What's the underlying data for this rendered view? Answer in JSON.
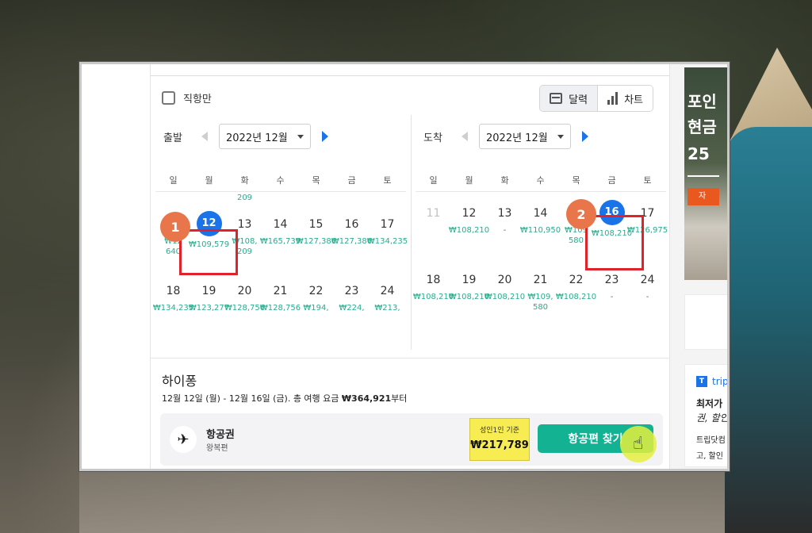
{
  "filters": {
    "direct_only_label": "직항만"
  },
  "view_toggle": {
    "calendar_label": "달력",
    "chart_label": "차트"
  },
  "departure": {
    "label": "출발",
    "month": "2022년 12월",
    "weekdays": [
      "일",
      "월",
      "화",
      "수",
      "목",
      "금",
      "토"
    ],
    "partial_row_price": "209",
    "rows": [
      [
        {
          "day": "11",
          "price": "₩12\n640",
          "muted": false
        },
        {
          "day": "12",
          "price": "₩109,579",
          "selected": true
        },
        {
          "day": "13",
          "price": "₩108,\n209"
        },
        {
          "day": "14",
          "price": "₩165,739"
        },
        {
          "day": "15",
          "price": "₩127,386"
        },
        {
          "day": "16",
          "price": "₩127,386"
        },
        {
          "day": "17",
          "price": "₩134,235"
        }
      ],
      [
        {
          "day": "18",
          "price": "₩134,235"
        },
        {
          "day": "19",
          "price": "₩123,277"
        },
        {
          "day": "20",
          "price": "₩128,756"
        },
        {
          "day": "21",
          "price": "₩128,756"
        },
        {
          "day": "22",
          "price": "₩194,"
        },
        {
          "day": "23",
          "price": "₩224,"
        },
        {
          "day": "24",
          "price": "₩213,"
        }
      ]
    ]
  },
  "arrival": {
    "label": "도착",
    "month": "2022년 12월",
    "weekdays": [
      "일",
      "월",
      "화",
      "수",
      "목",
      "금",
      "토"
    ],
    "rows": [
      [
        {
          "day": "11",
          "price": "",
          "muted": true
        },
        {
          "day": "12",
          "price": "₩108,210"
        },
        {
          "day": "13",
          "price": "-",
          "dash": true
        },
        {
          "day": "14",
          "price": "₩110,950"
        },
        {
          "day": "15",
          "price": "₩109\n580"
        },
        {
          "day": "16",
          "price": "₩108,210",
          "selected": true
        },
        {
          "day": "17",
          "price": "₩126,975"
        }
      ],
      [
        {
          "day": "18",
          "price": "₩108,210"
        },
        {
          "day": "19",
          "price": "₩108,210"
        },
        {
          "day": "20",
          "price": "₩108,210"
        },
        {
          "day": "21",
          "price": "₩109,\n580"
        },
        {
          "day": "22",
          "price": "₩108,210"
        },
        {
          "day": "23",
          "price": "-",
          "dash": true
        },
        {
          "day": "24",
          "price": "-",
          "dash": true
        }
      ]
    ]
  },
  "annotations": {
    "badge_1": "1",
    "badge_2": "2"
  },
  "result": {
    "airline": "하이퐁",
    "summary_prefix": "12월 12일 (월) - 12월 16일 (금). 총 여행 요금 ",
    "summary_total": "₩364,921",
    "summary_suffix": "부터",
    "fare_type": "항공권",
    "fare_sub": "왕복편",
    "price_label": "성인1인 기준",
    "price": "₩217,789",
    "search_button": "항공편 찾기"
  },
  "ad": {
    "lines": [
      "포인",
      "현금",
      "25"
    ],
    "orange_text": "자",
    "trip_brand": "trip",
    "trip_line1": "최저가",
    "trip_line2": "권, 할인",
    "trip_line3": "트립닷컴",
    "trip_line4": "고, 할인"
  },
  "colors": {
    "accent_blue": "#1a73e8",
    "price_green": "#2bab8d",
    "cta_teal": "#13b293",
    "highlight_red": "#e0232a",
    "badge_orange": "#e8764a",
    "price_yellow": "#f7ec52"
  }
}
